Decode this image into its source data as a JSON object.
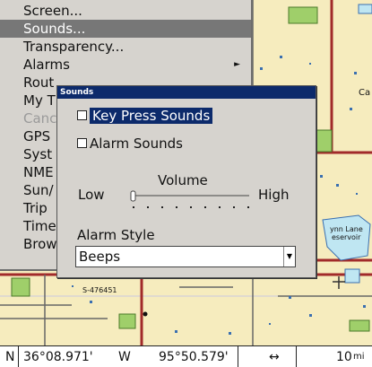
{
  "menu": {
    "items": [
      {
        "label": "Screen...",
        "state": "normal"
      },
      {
        "label": "Sounds...",
        "state": "selected"
      },
      {
        "label": "Transparency...",
        "state": "normal"
      },
      {
        "label": "Alarms",
        "state": "normal",
        "submenu": true
      },
      {
        "label": "Rout",
        "state": "normal"
      },
      {
        "label": "My T",
        "state": "normal"
      },
      {
        "label": "Canc",
        "state": "disabled"
      },
      {
        "label": "GPS",
        "state": "normal"
      },
      {
        "label": "Syst",
        "state": "normal"
      },
      {
        "label": "NME",
        "state": "normal"
      },
      {
        "label": "Sun/",
        "state": "normal"
      },
      {
        "label": "Trip",
        "state": "normal"
      },
      {
        "label": "Time",
        "state": "normal"
      },
      {
        "label": "Brow",
        "state": "normal"
      }
    ]
  },
  "dialog": {
    "title": "Sounds",
    "key_press_label": "Key Press Sounds",
    "key_press_checked": false,
    "alarm_label": "Alarm Sounds",
    "alarm_checked": false,
    "volume_label": "Volume",
    "low_label": "Low",
    "high_label": "High",
    "volume_level": 0.0,
    "alarm_style_label": "Alarm Style",
    "alarm_style_value": "Beeps"
  },
  "map": {
    "labels": {
      "partial_c": "Ca",
      "lake_line1": "ynn Lane",
      "lake_line2": "eservoir",
      "road_label": "S-476451"
    }
  },
  "status": {
    "lat_value": "36°08.971'",
    "lat_prefix": "N",
    "lon_prefix": "W",
    "lon_value": "95°50.579'",
    "arrow": "↔",
    "range": "10",
    "range_unit": "mi"
  },
  "colors": {
    "menu_bg": "#d6d3ce",
    "selection": "#777777",
    "dialog_title": "#0c2a6b",
    "map_bg": "#f6ecbe",
    "road_red": "#a12a2a",
    "water": "#bfe6f2",
    "park": "#7fb34a"
  }
}
